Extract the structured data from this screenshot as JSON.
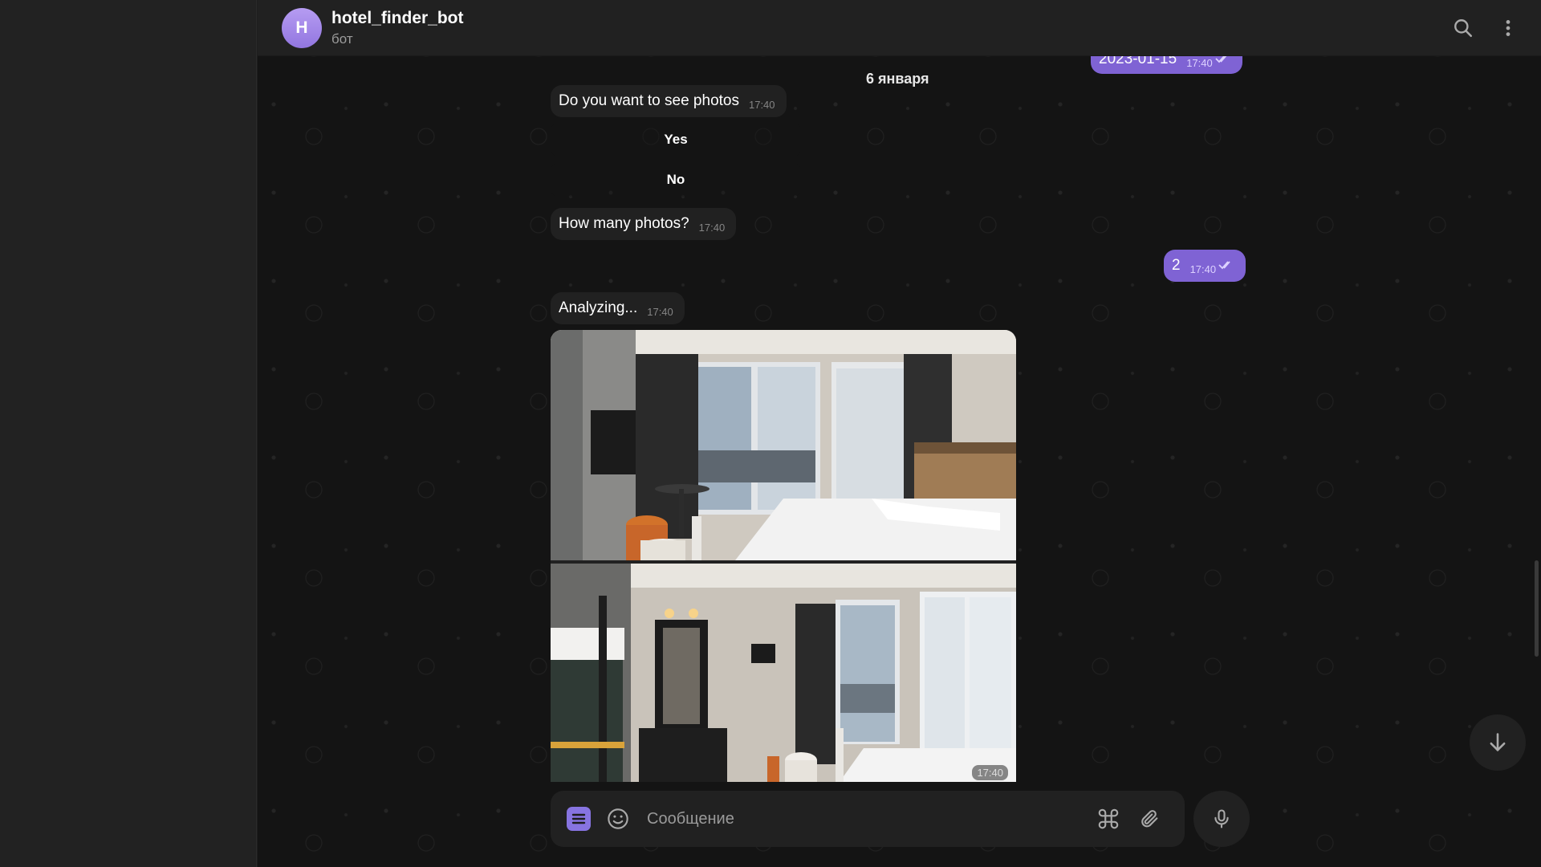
{
  "header": {
    "avatar_letter": "H",
    "title": "hotel_finder_bot",
    "subtitle": "бот"
  },
  "date_separator": "6 января",
  "messages": [
    {
      "direction": "out",
      "text": "2023-01-15",
      "time": "17:40"
    },
    {
      "direction": "in",
      "text": "Do you want to see photos",
      "time": "17:40"
    },
    {
      "direction": "in",
      "text": "How many photos?",
      "time": "17:40"
    },
    {
      "direction": "out",
      "text": "2",
      "time": "17:40"
    },
    {
      "direction": "in",
      "text": "Analyzing...",
      "time": "17:40"
    }
  ],
  "keyboard": [
    "Yes",
    "No"
  ],
  "photo_group": {
    "time": "17:40"
  },
  "composer": {
    "placeholder": "Сообщение"
  },
  "colors": {
    "accent": "#8774e1",
    "outgoing_bubble": "#7f63d4",
    "incoming_bubble": "#212121",
    "background": "#141414"
  }
}
